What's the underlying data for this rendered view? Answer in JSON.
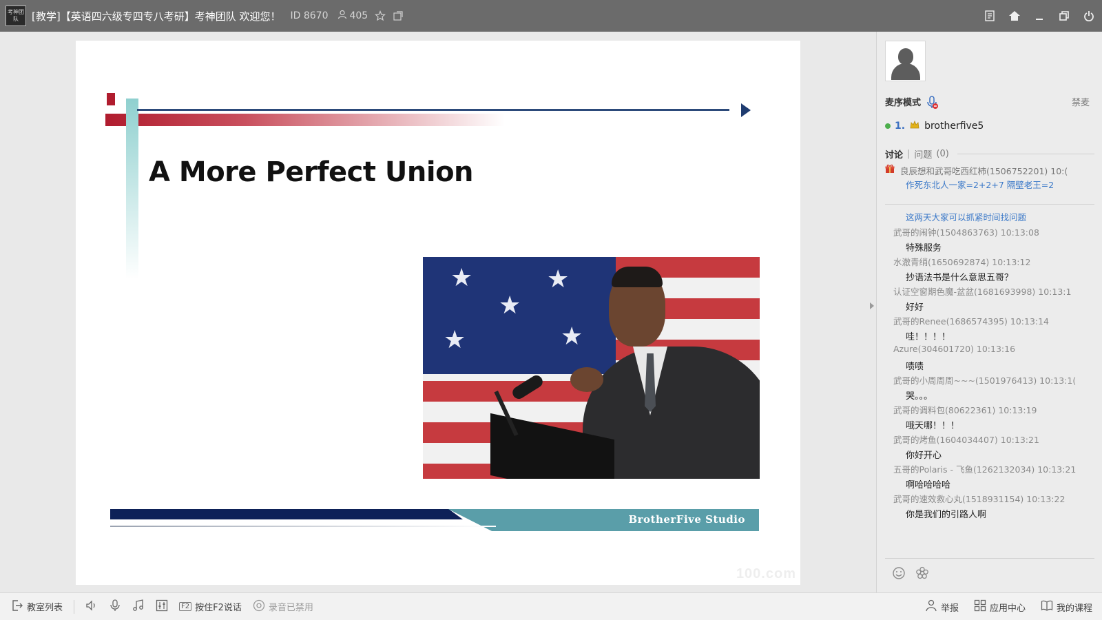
{
  "titlebar": {
    "logo_text": "考神团队",
    "room_title": "[教学]【英语四六级专四专八考研】考神团队 欢迎您！",
    "room_id": "ID 8670",
    "online_count": "405",
    "icons": [
      "user-icon",
      "star-icon",
      "share-icon",
      "notes-icon",
      "home-icon",
      "minimize-icon",
      "restore-icon",
      "power-icon"
    ]
  },
  "slide": {
    "title": "A More Perfect Union",
    "footer_brand": "BrotherFive Studio",
    "watermark": "100.com",
    "colors": {
      "accent_red": "#b01c2e",
      "navy": "#0d2158",
      "teal": "#5a9ea9",
      "mint": "#8fd0cf"
    }
  },
  "sidebar": {
    "mic_mode_label": "麦序模式",
    "mute_all_label": "禁麦",
    "queue": [
      {
        "num": "1.",
        "name": "brotherfive5"
      }
    ],
    "tabs": {
      "discussion": "讨论",
      "questions": "问题",
      "questions_count": "(0)"
    },
    "gift": {
      "meta": "良辰想和武哥吃西红柿(1506752201) 10:(",
      "message": "作死东北人一家=2+2+7 隔壁老王=2"
    },
    "notice": "这两天大家可以抓紧时间找问题",
    "messages": [
      {
        "meta": "武哥的闹钟(1504863763) 10:13:08",
        "text": "特殊服务"
      },
      {
        "meta": "水澈青绡(1650692874) 10:13:12",
        "text": "抄语法书是什么意思五哥？"
      },
      {
        "meta": "认证空窗期色魔-盆盆(1681693998) 10:13:1",
        "text": "好好"
      },
      {
        "meta": "武哥的Renee(1686574395) 10:13:14",
        "text": "哇！！！！"
      },
      {
        "meta": "Azure(304601720) 10:13:16",
        "text": "啧啧"
      },
      {
        "meta": "武哥的小周周周~~~(1501976413) 10:13:1(",
        "text": "哭。。。"
      },
      {
        "meta": "武哥的调料包(80622361) 10:13:19",
        "text": "哦天哪！！！"
      },
      {
        "meta": "武哥的烤鱼(1604034407) 10:13:21",
        "text": "你好开心"
      },
      {
        "meta": "五哥的Polaris - 飞鱼(1262132034) 10:13:21",
        "text": "啊哈哈哈哈"
      },
      {
        "meta": "武哥的速效救心丸(1518931154) 10:13:22",
        "text": "你是我们的引路人啊"
      }
    ],
    "input": {
      "value": "",
      "placeholder": ""
    }
  },
  "bottombar": {
    "classroom_list": "教室列表",
    "push_to_talk": "按住F2说话",
    "f2_key": "F2",
    "record_disabled": "录音已禁用",
    "report": "举报",
    "app_center": "应用中心",
    "my_courses": "我的课程"
  }
}
